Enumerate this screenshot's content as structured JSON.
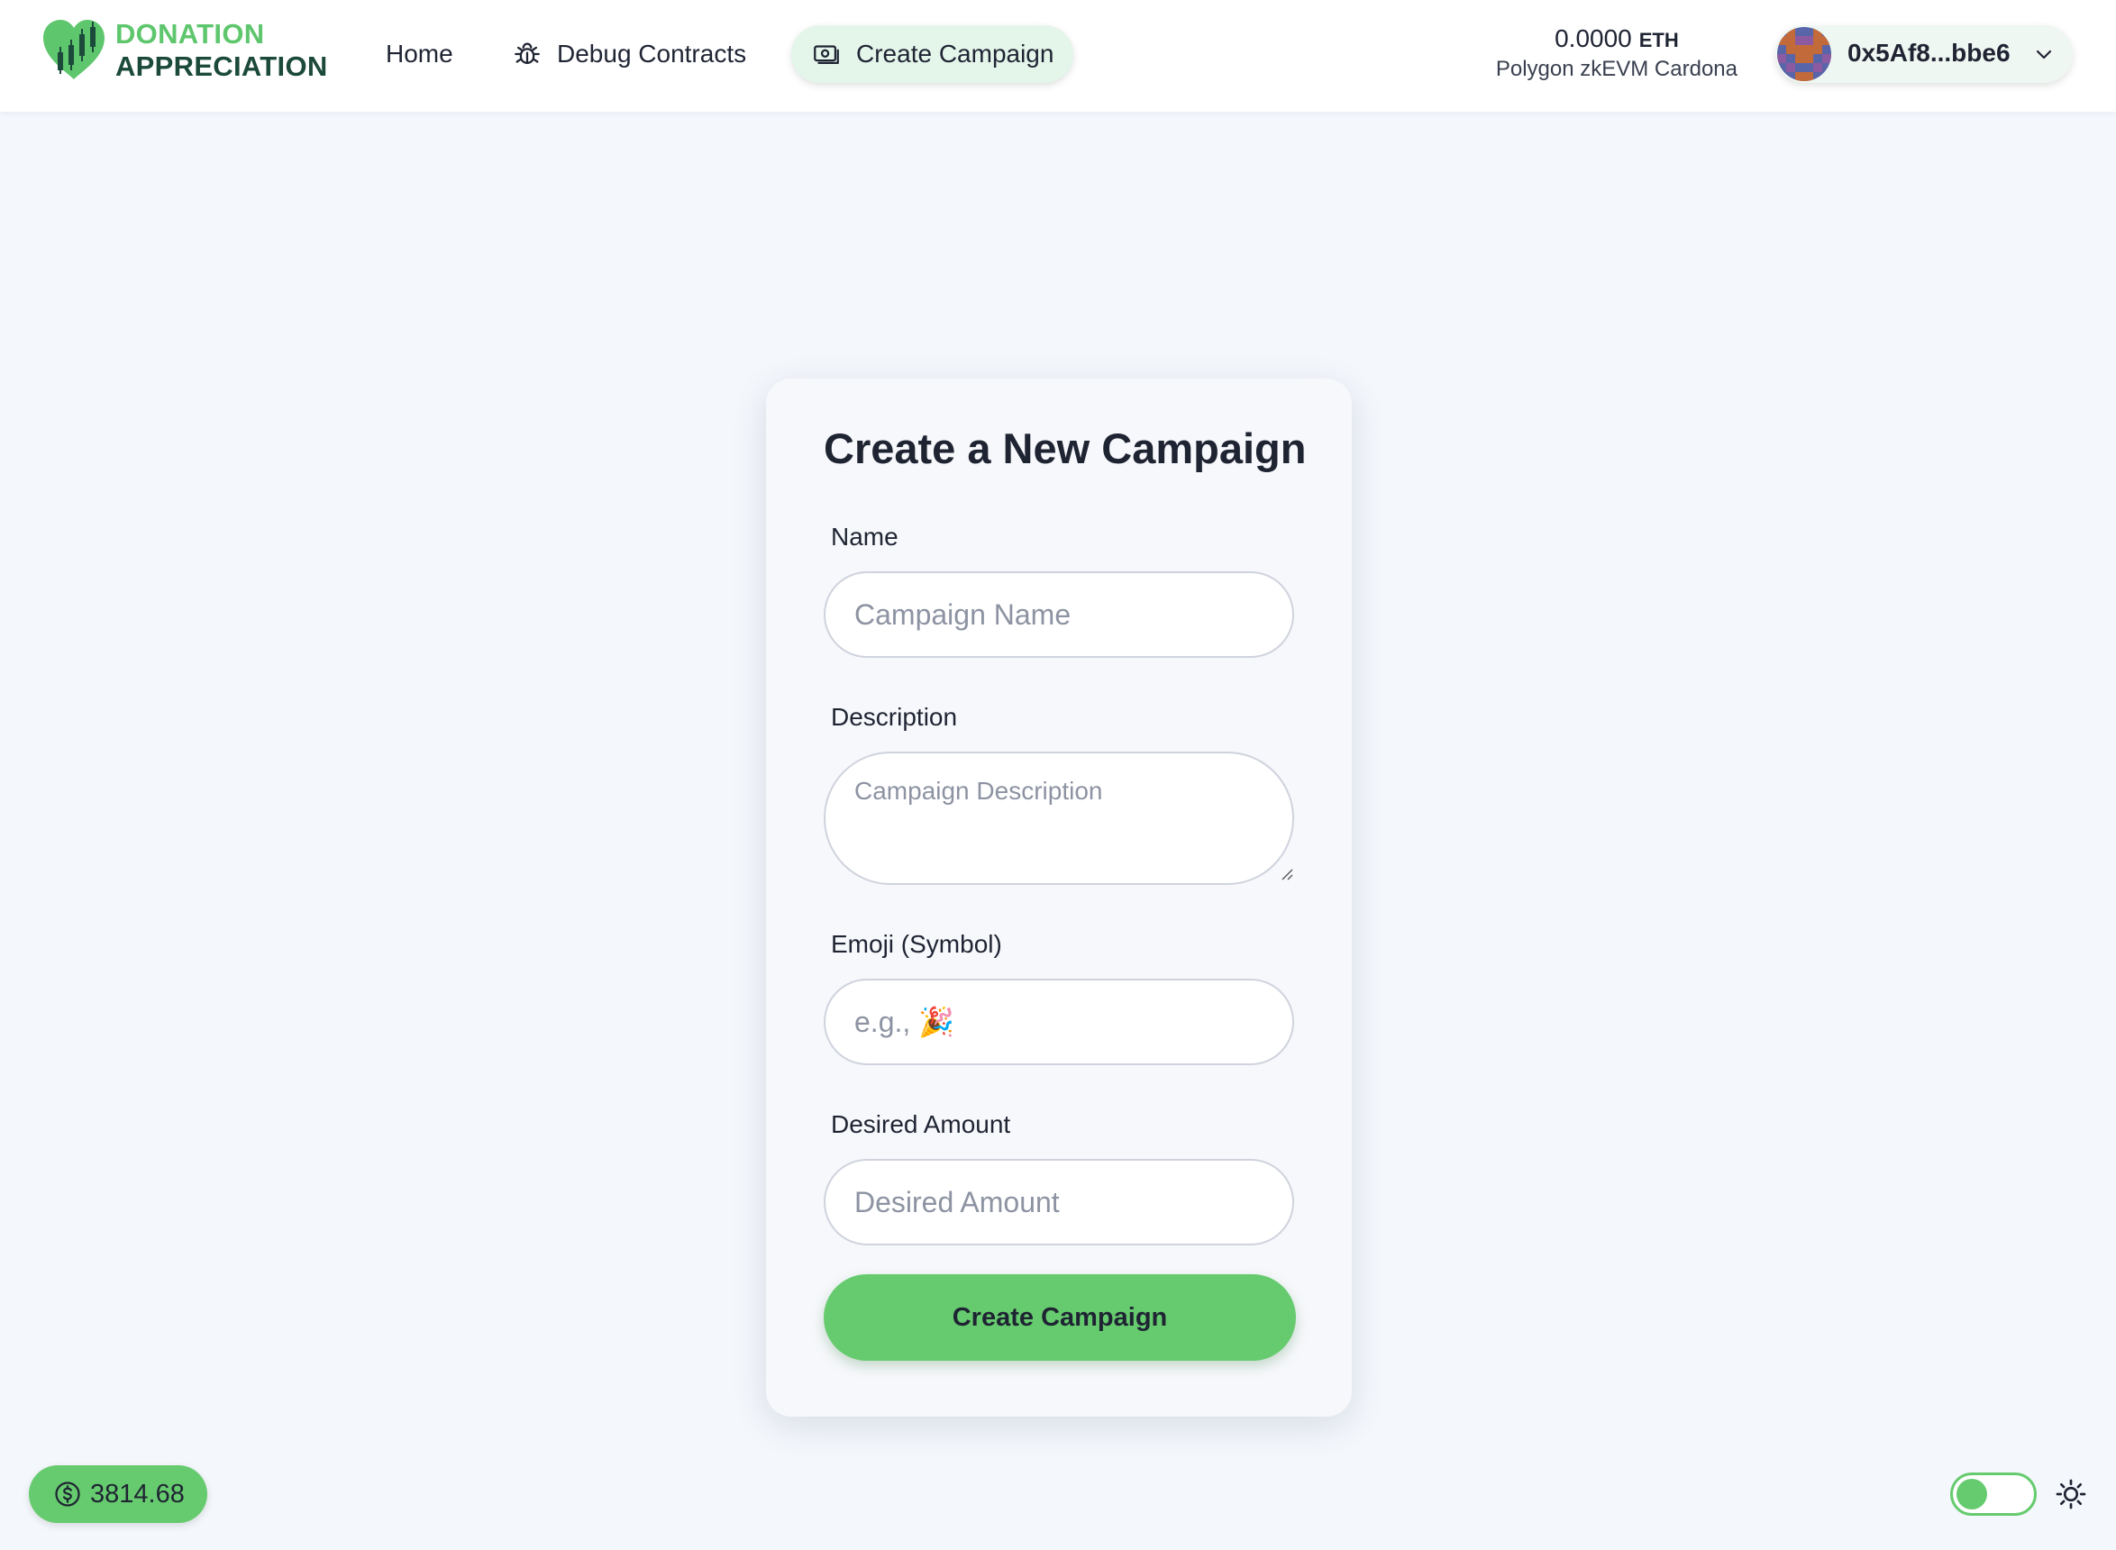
{
  "brand": {
    "line1": "DONATION",
    "line2": "APPRECIATION"
  },
  "nav": {
    "home": "Home",
    "debug": "Debug Contracts",
    "create": "Create Campaign"
  },
  "wallet": {
    "balance": "0.0000",
    "unit": "ETH",
    "network": "Polygon zkEVM Cardona",
    "address": "0x5Af8...bbe6"
  },
  "form": {
    "title": "Create a New Campaign",
    "name_label": "Name",
    "name_placeholder": "Campaign Name",
    "description_label": "Description",
    "description_placeholder": "Campaign Description",
    "emoji_label": "Emoji (Symbol)",
    "emoji_placeholder": "e.g., 🎉",
    "amount_label": "Desired Amount",
    "amount_placeholder": "Desired Amount",
    "submit_label": "Create Campaign"
  },
  "footer": {
    "price": "3814.68",
    "theme_toggle_on": true
  },
  "icons": {
    "logo": "heart-chart-icon",
    "debug": "bug-icon",
    "create": "banknote-icon",
    "price": "dollar-circle-icon",
    "theme": "sun-icon",
    "dropdown": "chevron-down-icon"
  },
  "colors": {
    "accent": "#66cb6e",
    "brand_green": "#5ec66c",
    "brand_dark": "#1b4a3a",
    "background": "#f4f7fc"
  }
}
